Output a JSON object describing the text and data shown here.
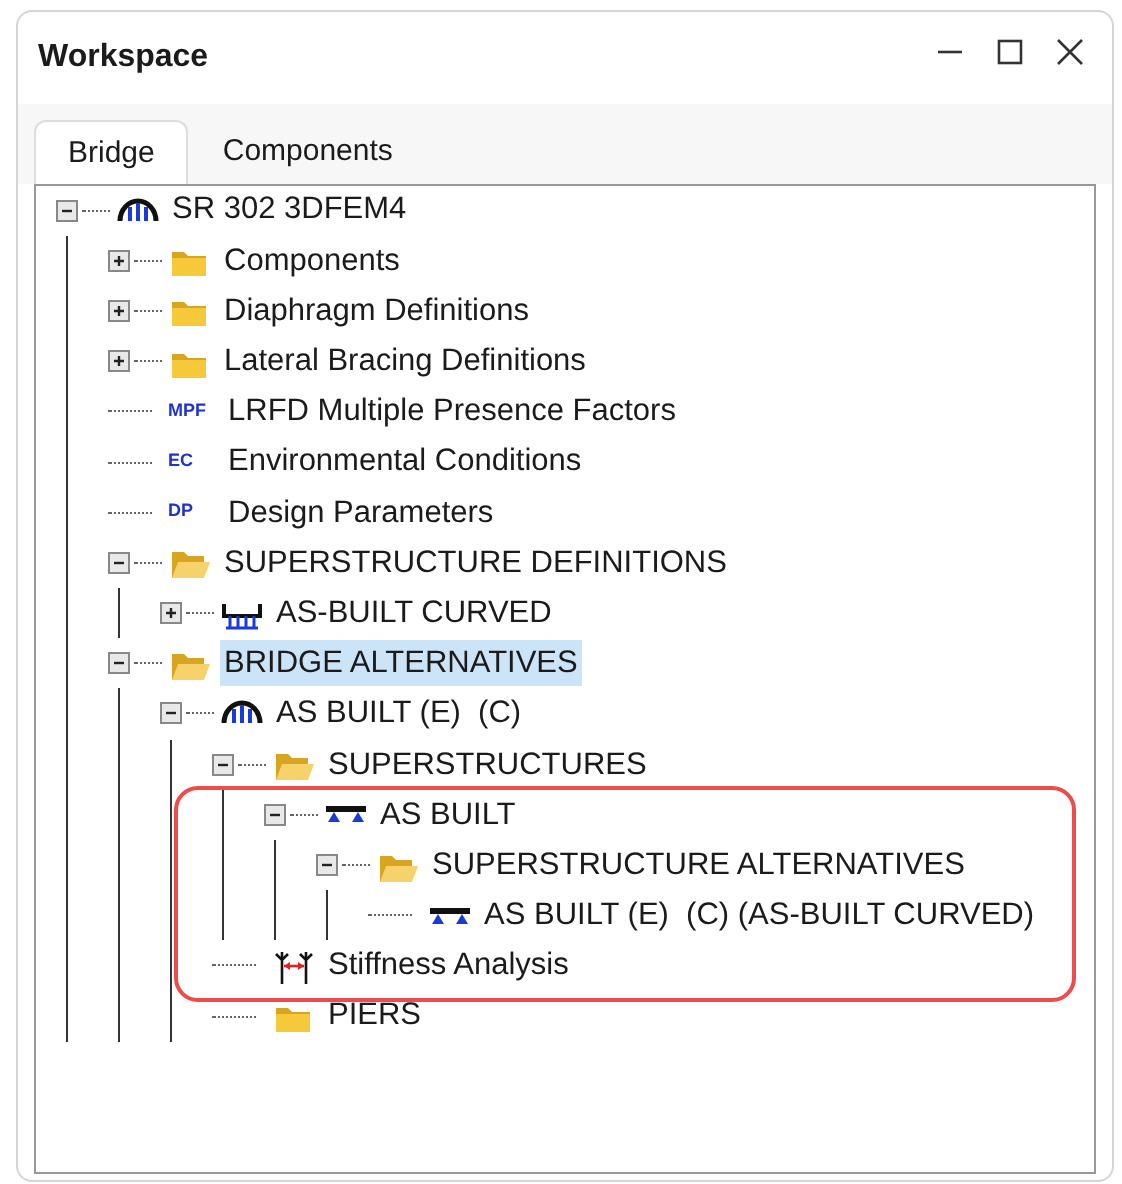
{
  "window": {
    "title": "Workspace"
  },
  "tabs": [
    {
      "label": "Bridge",
      "selected": true
    },
    {
      "label": "Components",
      "selected": false
    }
  ],
  "tree": [
    {
      "label": "SR 302 3DFEM4",
      "kind": "bridge",
      "expanded": true,
      "selected": false,
      "children": [
        {
          "label": "Components",
          "kind": "folder",
          "expanded": false,
          "selected": false
        },
        {
          "label": "Diaphragm Definitions",
          "kind": "folder",
          "expanded": false,
          "selected": false
        },
        {
          "label": "Lateral Bracing Definitions",
          "kind": "folder",
          "expanded": false,
          "selected": false
        },
        {
          "label": "LRFD Multiple Presence Factors",
          "kind": "text",
          "icon_text": "MPF",
          "selected": false
        },
        {
          "label": "Environmental Conditions",
          "kind": "text",
          "icon_text": "EC",
          "selected": false
        },
        {
          "label": "Design Parameters",
          "kind": "text",
          "icon_text": "DP",
          "selected": false
        },
        {
          "label": "SUPERSTRUCTURE DEFINITIONS",
          "kind": "folder_open",
          "expanded": true,
          "selected": false,
          "children": [
            {
              "label": "AS-BUILT CURVED",
              "kind": "girder_system",
              "expanded": false,
              "selected": false
            }
          ]
        },
        {
          "label": "BRIDGE ALTERNATIVES",
          "kind": "folder_open",
          "expanded": true,
          "selected": true,
          "children": [
            {
              "label": "AS BUILT (E)  (C)",
              "kind": "bridge",
              "expanded": true,
              "selected": false,
              "children": [
                {
                  "label": "SUPERSTRUCTURES",
                  "kind": "folder_open",
                  "expanded": true,
                  "selected": false,
                  "children": [
                    {
                      "label": "AS BUILT",
                      "kind": "superstructure",
                      "expanded": true,
                      "selected": false,
                      "children": [
                        {
                          "label": "SUPERSTRUCTURE ALTERNATIVES",
                          "kind": "folder_open",
                          "expanded": true,
                          "selected": false,
                          "children": [
                            {
                              "label": "AS BUILT (E)  (C) (AS-BUILT CURVED)",
                              "kind": "superstructure",
                              "selected": false
                            }
                          ]
                        }
                      ]
                    }
                  ]
                },
                {
                  "label": "Stiffness Analysis",
                  "kind": "stiffness",
                  "selected": false
                },
                {
                  "label": "PIERS",
                  "kind": "folder",
                  "selected": false
                }
              ]
            }
          ]
        }
      ]
    }
  ]
}
